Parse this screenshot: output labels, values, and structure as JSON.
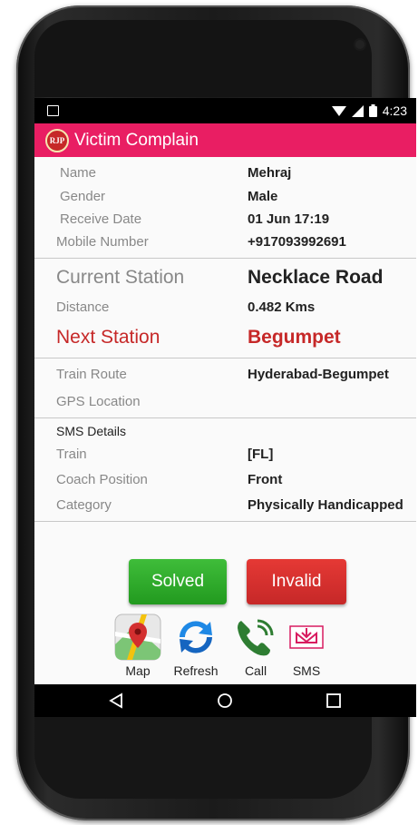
{
  "status_bar": {
    "time": "4:23"
  },
  "app_bar": {
    "logo_text": "RJP",
    "title": "Victim Complain"
  },
  "details": [
    {
      "label": "Name",
      "value": "Mehraj"
    },
    {
      "label": "Gender",
      "value": "Male"
    },
    {
      "label": "Receive Date",
      "value": "01 Jun 17:19"
    },
    {
      "label": "Mobile Number",
      "value": "+917093992691"
    }
  ],
  "station": {
    "current_label": "Current Station",
    "current_value": "Necklace Road",
    "distance_label": "Distance",
    "distance_value": "0.482 Kms",
    "next_label": "Next Station",
    "next_value": "Begumpet"
  },
  "route": {
    "train_route_label": "Train Route",
    "train_route_value": "Hyderabad-Begumpet",
    "gps_label": "GPS Location",
    "gps_value": ""
  },
  "sms": {
    "heading": "SMS Details",
    "train_label": "Train",
    "train_value": "[FL]",
    "coach_label": "Coach Position",
    "coach_value": "Front",
    "category_label": "Category",
    "category_value": "Physically Handicapped"
  },
  "buttons": {
    "solved": "Solved",
    "invalid": "Invalid"
  },
  "actions": [
    {
      "label": "Map",
      "icon": "map-icon"
    },
    {
      "label": "Refresh",
      "icon": "refresh-icon"
    },
    {
      "label": "Call",
      "icon": "phone-icon"
    },
    {
      "label": "SMS",
      "icon": "sms-icon"
    }
  ],
  "colors": {
    "appbar": "#e91e63",
    "accent_red": "#c62828",
    "solved_green": "#2eaa2a",
    "invalid_red": "#d32f2f"
  }
}
